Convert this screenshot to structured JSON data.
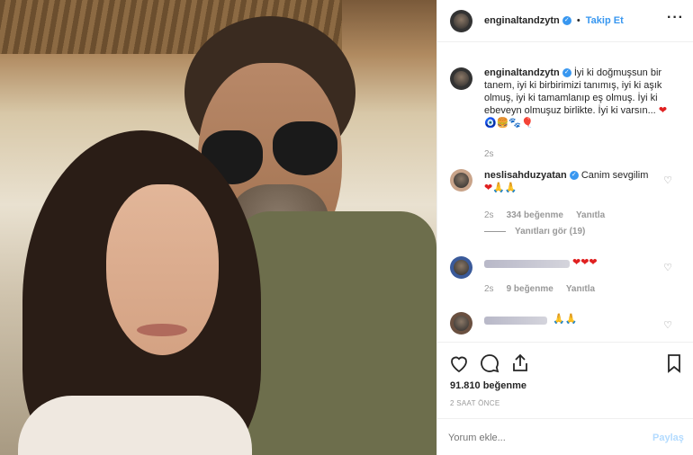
{
  "header": {
    "username": "enginaltandzytn",
    "verified_mark": "✓",
    "separator": "•",
    "follow_label": "Takip Et",
    "more_icon": "ellipsis-horizontal-icon"
  },
  "caption": {
    "username": "enginaltandzytn",
    "text": "İyi ki doğmuşsun bir tanem, iyi ki birbirimizi tanımış, iyi ki aşık olmuş, iyi ki tamamlanıp eş olmuş. İyi ki ebeveyn olmuşuz birlikte. İyi ki varsın...",
    "emojis": "❤🧿🍔🐾🎈",
    "time": "2s"
  },
  "comments": [
    {
      "username": "neslisahduzyatan",
      "text": "Canim sevgilim",
      "emojis": "❤🙏🙏",
      "time": "2s",
      "likes": "334 beğenme",
      "reply_label": "Yanıtla",
      "view_replies": "Yanıtları gör (19)"
    },
    {
      "emojis": "❤❤❤",
      "time": "2s",
      "likes": "9 beğenme",
      "reply_label": "Yanıtla"
    },
    {
      "emojis": "🙏🙏"
    }
  ],
  "actions": {
    "like_icon": "heart-outline-icon",
    "comment_icon": "comment-bubble-icon",
    "share_icon": "share-upload-icon",
    "save_icon": "bookmark-icon"
  },
  "stats": {
    "likes": "91.810 beğenme",
    "posted": "2 SAAT ÖNCE"
  },
  "composer": {
    "placeholder": "Yorum ekle...",
    "post_label": "Paylaş"
  }
}
